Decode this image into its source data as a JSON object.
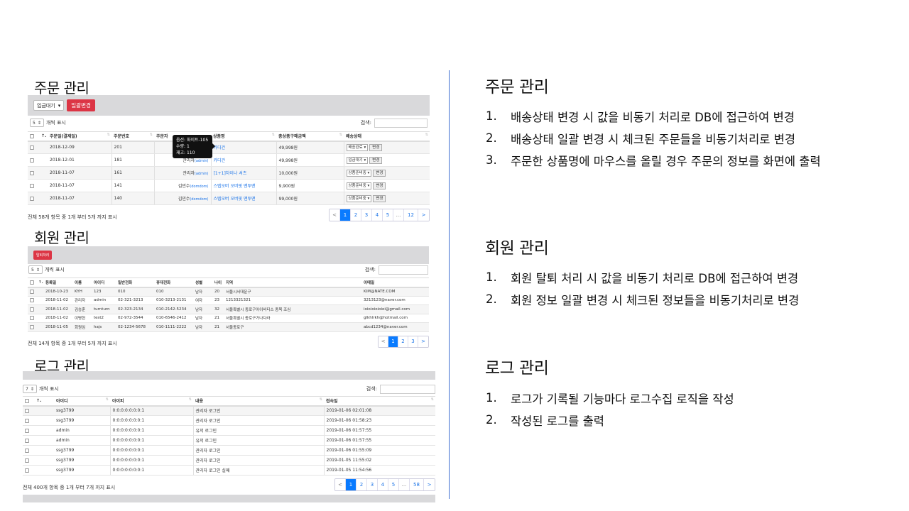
{
  "order": {
    "title": "주문 관리",
    "status_select": "입금대기",
    "bulk_button": "일괄변경",
    "page_size": "5",
    "page_size_suffix": "개씩 표시",
    "search_label": "검색:",
    "headers": [
      "↑.",
      "주문일(결제일)",
      "주문번호",
      "주문자",
      "상품명",
      "총상품구매금액",
      "배송상태"
    ],
    "rows": [
      {
        "date": "2018-12-09",
        "no": "201",
        "buyer": "",
        "buyer_sub": "",
        "product": "카디건",
        "amount": "49,998원",
        "status": "배송완료"
      },
      {
        "date": "2018-12-01",
        "no": "181",
        "buyer": "관리자",
        "buyer_sub": "(admin)",
        "product": "카디건",
        "amount": "49,998원",
        "status": "입금대기"
      },
      {
        "date": "2018-11-07",
        "no": "161",
        "buyer": "관리자",
        "buyer_sub": "(admin)",
        "product": "[1+1]차이나 셔츠",
        "amount": "10,000원",
        "status": "상품준비중"
      },
      {
        "date": "2018-11-07",
        "no": "141",
        "buyer": "김민수",
        "buyer_sub": "(domdom)",
        "product": "스텝오버 오버핏 맨투맨",
        "amount": "9,900원",
        "status": "상품준비중"
      },
      {
        "date": "2018-11-07",
        "no": "140",
        "buyer": "김민수",
        "buyer_sub": "(domdom)",
        "product": "스텝오버 오버핏 맨투맨",
        "amount": "99,000원",
        "status": "상품준비중"
      }
    ],
    "change_label": "변경",
    "tooltip": [
      "옵션: 화이트-105",
      "수량: 1",
      "재고: 110"
    ],
    "footer": "전체 58개 항목 중 1개 부터 5개 까지 표시",
    "pager": [
      "<",
      "1",
      "2",
      "3",
      "4",
      "5",
      "...",
      "12",
      ">"
    ]
  },
  "member": {
    "title": "회원 관리",
    "withdraw_button": "탈퇴처리",
    "page_size": "5",
    "page_size_suffix": "개씩 표시",
    "search_label": "검색:",
    "headers": [
      "↑.",
      "등록일",
      "이름",
      "아이디",
      "일반전화",
      "휴대전화",
      "성별",
      "나이",
      "지역",
      "이메일"
    ],
    "rows": [
      [
        "2018-10-23",
        "KYH",
        "123",
        "010",
        "010",
        "남자",
        "20",
        "서울시서대문구",
        "KIM@NATE.COM"
      ],
      [
        "2018-11-02",
        "관리자",
        "admin",
        "02-321-3213",
        "010-3213-2131",
        "여자",
        "23",
        "1213321321",
        "3213123@naver.com"
      ],
      [
        "2018-11-02",
        "김승훈",
        "turnturn",
        "02-323-2134",
        "010-2142-5234",
        "남자",
        "32",
        "서울특별시 종로구아이비티스 종목 조심",
        "ioioioioioioi@gmail.com"
      ],
      [
        "2018-11-02",
        "이병헌",
        "test2",
        "02-972-3544",
        "010-6546-2412",
        "남자",
        "21",
        "서울특별시 종로구가나다라",
        "glkhlrkh@hotmail.com"
      ],
      [
        "2018-11-05",
        "회원임",
        "hajs",
        "02-1234-5678",
        "010-1111-2222",
        "남자",
        "21",
        "서울종로구",
        "abcd1234@naver.com"
      ]
    ],
    "footer": "전체 14개 항목 중 1개 부터 5개 까지 표시",
    "pager": [
      "<",
      "1",
      "2",
      "3",
      ">"
    ]
  },
  "log": {
    "title": "로그 관리",
    "page_size": "7",
    "page_size_suffix": "개씩 표시",
    "search_label": "검색:",
    "headers": [
      "↑.",
      "아이디",
      "아이피",
      "내용",
      "접속일"
    ],
    "rows": [
      [
        "ssg3799",
        "0:0:0:0:0:0:0:1",
        "관리자 로그인",
        "2019-01-06 02:01:08"
      ],
      [
        "ssg3799",
        "0:0:0:0:0:0:0:1",
        "관리자 로그인",
        "2019-01-06 01:58:23"
      ],
      [
        "admin",
        "0:0:0:0:0:0:0:1",
        "유저 로그인",
        "2019-01-06 01:57:55"
      ],
      [
        "admin",
        "0:0:0:0:0:0:0:1",
        "유저 로그인",
        "2019-01-06 01:57:55"
      ],
      [
        "ssg3799",
        "0:0:0:0:0:0:0:1",
        "관리자 로그인",
        "2019-01-06 01:55:09"
      ],
      [
        "ssg3799",
        "0:0:0:0:0:0:0:1",
        "관리자 로그인",
        "2019-01-05 11:55:02"
      ],
      [
        "ssg3799",
        "0:0:0:0:0:0:0:1",
        "관리자 로그인 실패",
        "2019-01-05 11:54:56"
      ]
    ],
    "footer": "전체 400개 항목 중 1개 부터 7개 까지 표시",
    "pager": [
      "<",
      "1",
      "2",
      "3",
      "4",
      "5",
      "...",
      "58",
      ">"
    ]
  },
  "right": {
    "order_title": "주문 관리",
    "order_items": [
      "배송상태 변경 시 값을 비동기 처리로 DB에 접근하여 변경",
      "배송상태 일괄 변경 시 체크된 주문들을 비동기처리로 변경",
      "주문한 상품명에 마우스를 올릴 경우 주문의 정보를 화면에 출력"
    ],
    "member_title": "회원 관리",
    "member_items": [
      "회원 탈퇴 처리 시 값을 비동기 처리로 DB에 접근하여 변경",
      "회원 정보 일괄 변경 시 체크된 정보들을 비동기처리로 변경"
    ],
    "log_title": "로그 관리",
    "log_items": [
      "로그가 기록될 기능마다 로그수집 로직을 작성",
      "작성된 로그를 출력"
    ],
    "numbers": [
      "1.",
      "2.",
      "3."
    ]
  },
  "colors": {
    "accent_red": "#dc3545",
    "pager_active": "#0a7bff",
    "divider": "#3f6fd0"
  }
}
